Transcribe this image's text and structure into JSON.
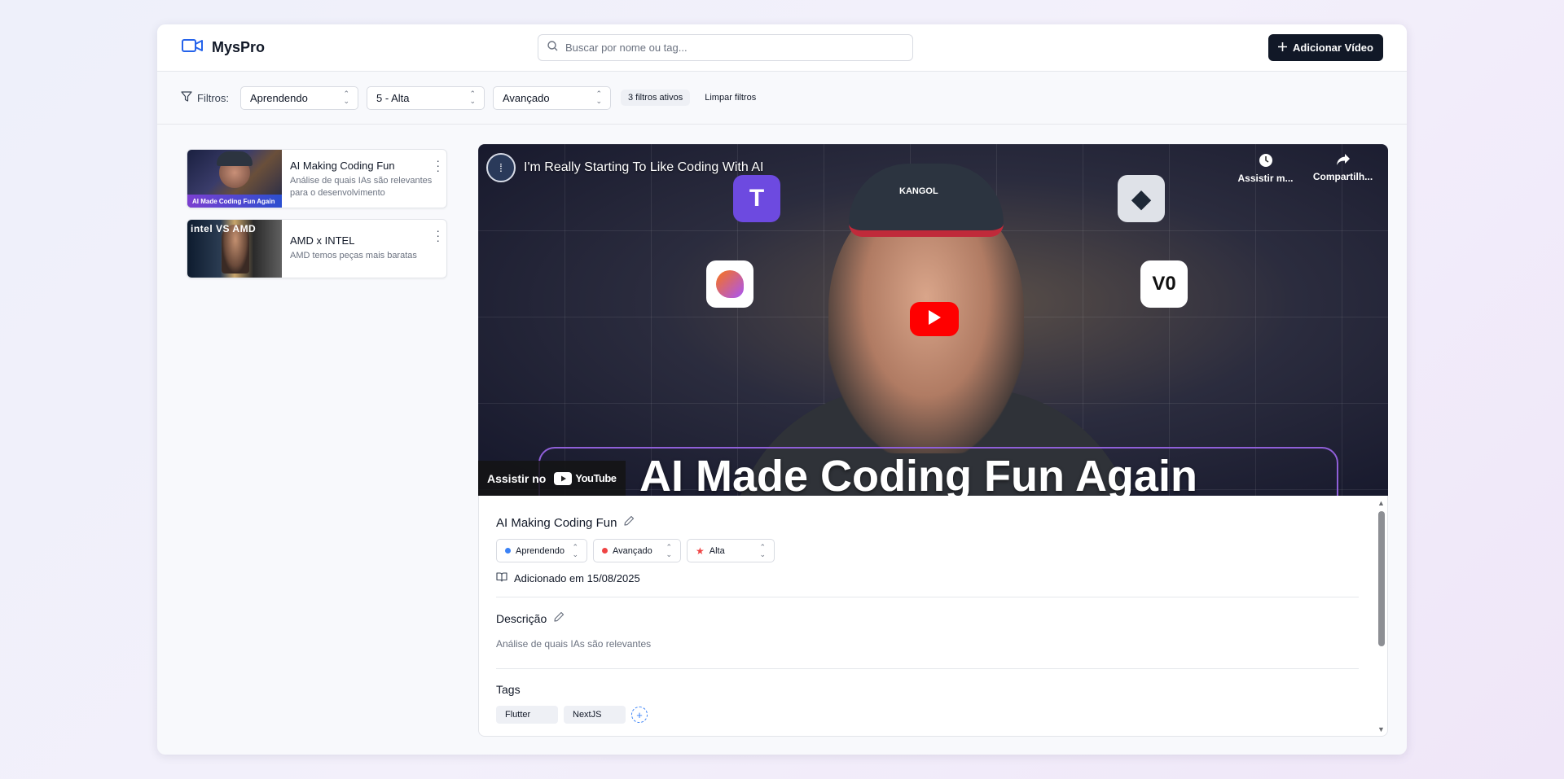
{
  "app": {
    "name": "MysPro"
  },
  "search": {
    "placeholder": "Buscar por nome ou tag..."
  },
  "header": {
    "add_button_label": "Adicionar Vídeo"
  },
  "filters": {
    "label": "Filtros:",
    "status": "Aprendendo",
    "priority": "5 - Alta",
    "level": "Avançado",
    "active_count": "3 filtros ativos",
    "clear_label": "Limpar filtros"
  },
  "videos": [
    {
      "title": "AI Making Coding Fun",
      "description": "Análise de quais IAs são relevantes para o desenvolvimento",
      "thumb_caption": "AI Made Coding Fun Again"
    },
    {
      "title": "AMD x INTEL",
      "description": "AMD temos peças mais baratas",
      "thumb_caption": "intel VS AMD"
    }
  ],
  "player": {
    "video_title": "I'm Really Starting To Like Coding With AI",
    "watch_later": "Assistir m...",
    "share": "Compartilh...",
    "watch_on": "Assistir no",
    "youtube": "YouTube",
    "overlay_text": "AI Made Coding Fun Again",
    "cap_text": "KANGOL"
  },
  "details": {
    "title": "AI Making Coding Fun",
    "status": {
      "label": "Aprendendo",
      "color": "#3b82f6"
    },
    "level": {
      "label": "Avançado",
      "color": "#ef4444"
    },
    "priority": {
      "label": "Alta",
      "color": "#ef4444"
    },
    "added_on": "Adicionado em 15/08/2025",
    "description_heading": "Descrição",
    "description": "Análise de quais IAs são relevantes",
    "tags_heading": "Tags",
    "tags": [
      "Flutter",
      "NextJS"
    ]
  },
  "colors": {
    "accent": "#2563eb",
    "primary_button": "#111827",
    "youtube_red": "#ff0000"
  }
}
